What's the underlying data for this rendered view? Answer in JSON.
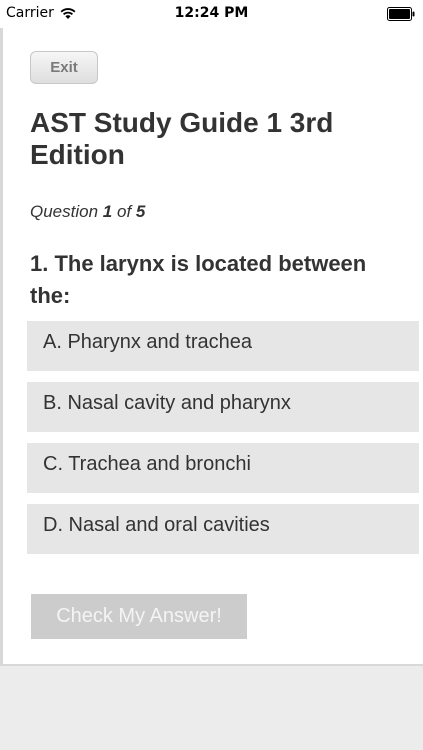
{
  "status_bar": {
    "carrier": "Carrier",
    "time": "12:24 PM"
  },
  "toolbar": {
    "exit_label": "Exit"
  },
  "quiz": {
    "title": "AST Study Guide 1 3rd Edition",
    "counter": {
      "prefix": "Question",
      "current": "1",
      "separator": "of",
      "total": "5"
    },
    "question": "1. The larynx is located between the:",
    "answers": [
      {
        "label": "A. Pharynx and trachea"
      },
      {
        "label": "B. Nasal cavity and pharynx"
      },
      {
        "label": "C. Trachea and bronchi"
      },
      {
        "label": "D. Nasal and oral cavities"
      }
    ],
    "submit_label": "Check My Answer!"
  }
}
